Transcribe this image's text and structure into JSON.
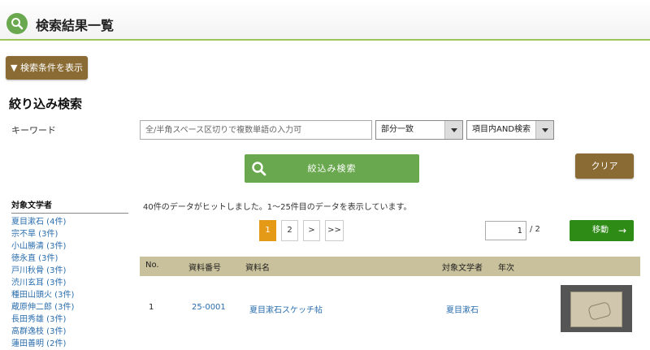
{
  "header": {
    "title": "検索結果一覧"
  },
  "toggle_conditions": {
    "label": "▼ 検索条件を表示"
  },
  "refine": {
    "title": "絞り込み検索",
    "keyword_label": "キーワード",
    "keyword_placeholder": "全/半角スペース区切りで複数単語の入力可",
    "keyword_value": "",
    "match_select": "部分一致",
    "scope_select": "項目内AND検索",
    "search_button": "絞込み検索",
    "clear_button": "クリア"
  },
  "sidebar": {
    "heading": "対象文学者",
    "items": [
      "夏目漱石 (4件)",
      "宗不旱 (3件)",
      "小山勝清 (3件)",
      "徳永直 (3件)",
      "戸川秋骨 (3件)",
      "渋川玄耳 (3件)",
      "種田山頭火 (3件)",
      "蔵原伸二郎 (3件)",
      "長田秀雄 (3件)",
      "高群逸枝 (3件)",
      "蓮田善明 (2件)"
    ]
  },
  "results": {
    "summary": "40件のデータがヒットしました。1～25件目のデータを表示しています。",
    "pages": [
      "1",
      "2",
      ">",
      ">>"
    ],
    "current_page": "1",
    "page_input": "1",
    "page_total": "/ 2",
    "move_button": "移動",
    "move_arrow": "→",
    "columns": {
      "no": "No.",
      "id": "資料番号",
      "name": "資料名",
      "author": "対象文学者",
      "year": "年次"
    },
    "rows": [
      {
        "no": "1",
        "id": "25-0001",
        "name": "夏目漱石スケッチ帖",
        "author": "夏目漱石",
        "year": ""
      }
    ]
  },
  "colors": {
    "accent_green": "#6aa84f",
    "brown_button": "#8a6b34",
    "move_green": "#2e8b16",
    "active_page": "#e59a17",
    "table_header": "#c9c19b",
    "link": "#2a6dad"
  },
  "icons": {
    "logo": "search-icon",
    "search_button": "search-icon",
    "move": "arrow-right-icon"
  }
}
